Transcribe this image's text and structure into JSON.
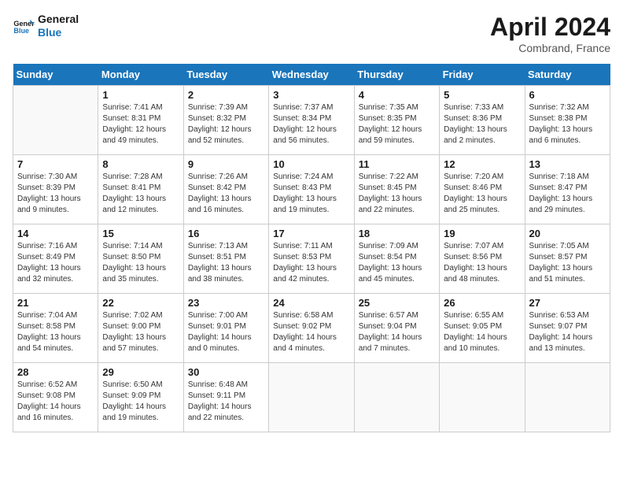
{
  "header": {
    "logo_line1": "General",
    "logo_line2": "Blue",
    "month_title": "April 2024",
    "location": "Combrand, France"
  },
  "days_of_week": [
    "Sunday",
    "Monday",
    "Tuesday",
    "Wednesday",
    "Thursday",
    "Friday",
    "Saturday"
  ],
  "weeks": [
    [
      {
        "day": "",
        "info": ""
      },
      {
        "day": "1",
        "info": "Sunrise: 7:41 AM\nSunset: 8:31 PM\nDaylight: 12 hours\nand 49 minutes."
      },
      {
        "day": "2",
        "info": "Sunrise: 7:39 AM\nSunset: 8:32 PM\nDaylight: 12 hours\nand 52 minutes."
      },
      {
        "day": "3",
        "info": "Sunrise: 7:37 AM\nSunset: 8:34 PM\nDaylight: 12 hours\nand 56 minutes."
      },
      {
        "day": "4",
        "info": "Sunrise: 7:35 AM\nSunset: 8:35 PM\nDaylight: 12 hours\nand 59 minutes."
      },
      {
        "day": "5",
        "info": "Sunrise: 7:33 AM\nSunset: 8:36 PM\nDaylight: 13 hours\nand 2 minutes."
      },
      {
        "day": "6",
        "info": "Sunrise: 7:32 AM\nSunset: 8:38 PM\nDaylight: 13 hours\nand 6 minutes."
      }
    ],
    [
      {
        "day": "7",
        "info": "Sunrise: 7:30 AM\nSunset: 8:39 PM\nDaylight: 13 hours\nand 9 minutes."
      },
      {
        "day": "8",
        "info": "Sunrise: 7:28 AM\nSunset: 8:41 PM\nDaylight: 13 hours\nand 12 minutes."
      },
      {
        "day": "9",
        "info": "Sunrise: 7:26 AM\nSunset: 8:42 PM\nDaylight: 13 hours\nand 16 minutes."
      },
      {
        "day": "10",
        "info": "Sunrise: 7:24 AM\nSunset: 8:43 PM\nDaylight: 13 hours\nand 19 minutes."
      },
      {
        "day": "11",
        "info": "Sunrise: 7:22 AM\nSunset: 8:45 PM\nDaylight: 13 hours\nand 22 minutes."
      },
      {
        "day": "12",
        "info": "Sunrise: 7:20 AM\nSunset: 8:46 PM\nDaylight: 13 hours\nand 25 minutes."
      },
      {
        "day": "13",
        "info": "Sunrise: 7:18 AM\nSunset: 8:47 PM\nDaylight: 13 hours\nand 29 minutes."
      }
    ],
    [
      {
        "day": "14",
        "info": "Sunrise: 7:16 AM\nSunset: 8:49 PM\nDaylight: 13 hours\nand 32 minutes."
      },
      {
        "day": "15",
        "info": "Sunrise: 7:14 AM\nSunset: 8:50 PM\nDaylight: 13 hours\nand 35 minutes."
      },
      {
        "day": "16",
        "info": "Sunrise: 7:13 AM\nSunset: 8:51 PM\nDaylight: 13 hours\nand 38 minutes."
      },
      {
        "day": "17",
        "info": "Sunrise: 7:11 AM\nSunset: 8:53 PM\nDaylight: 13 hours\nand 42 minutes."
      },
      {
        "day": "18",
        "info": "Sunrise: 7:09 AM\nSunset: 8:54 PM\nDaylight: 13 hours\nand 45 minutes."
      },
      {
        "day": "19",
        "info": "Sunrise: 7:07 AM\nSunset: 8:56 PM\nDaylight: 13 hours\nand 48 minutes."
      },
      {
        "day": "20",
        "info": "Sunrise: 7:05 AM\nSunset: 8:57 PM\nDaylight: 13 hours\nand 51 minutes."
      }
    ],
    [
      {
        "day": "21",
        "info": "Sunrise: 7:04 AM\nSunset: 8:58 PM\nDaylight: 13 hours\nand 54 minutes."
      },
      {
        "day": "22",
        "info": "Sunrise: 7:02 AM\nSunset: 9:00 PM\nDaylight: 13 hours\nand 57 minutes."
      },
      {
        "day": "23",
        "info": "Sunrise: 7:00 AM\nSunset: 9:01 PM\nDaylight: 14 hours\nand 0 minutes."
      },
      {
        "day": "24",
        "info": "Sunrise: 6:58 AM\nSunset: 9:02 PM\nDaylight: 14 hours\nand 4 minutes."
      },
      {
        "day": "25",
        "info": "Sunrise: 6:57 AM\nSunset: 9:04 PM\nDaylight: 14 hours\nand 7 minutes."
      },
      {
        "day": "26",
        "info": "Sunrise: 6:55 AM\nSunset: 9:05 PM\nDaylight: 14 hours\nand 10 minutes."
      },
      {
        "day": "27",
        "info": "Sunrise: 6:53 AM\nSunset: 9:07 PM\nDaylight: 14 hours\nand 13 minutes."
      }
    ],
    [
      {
        "day": "28",
        "info": "Sunrise: 6:52 AM\nSunset: 9:08 PM\nDaylight: 14 hours\nand 16 minutes."
      },
      {
        "day": "29",
        "info": "Sunrise: 6:50 AM\nSunset: 9:09 PM\nDaylight: 14 hours\nand 19 minutes."
      },
      {
        "day": "30",
        "info": "Sunrise: 6:48 AM\nSunset: 9:11 PM\nDaylight: 14 hours\nand 22 minutes."
      },
      {
        "day": "",
        "info": ""
      },
      {
        "day": "",
        "info": ""
      },
      {
        "day": "",
        "info": ""
      },
      {
        "day": "",
        "info": ""
      }
    ]
  ]
}
